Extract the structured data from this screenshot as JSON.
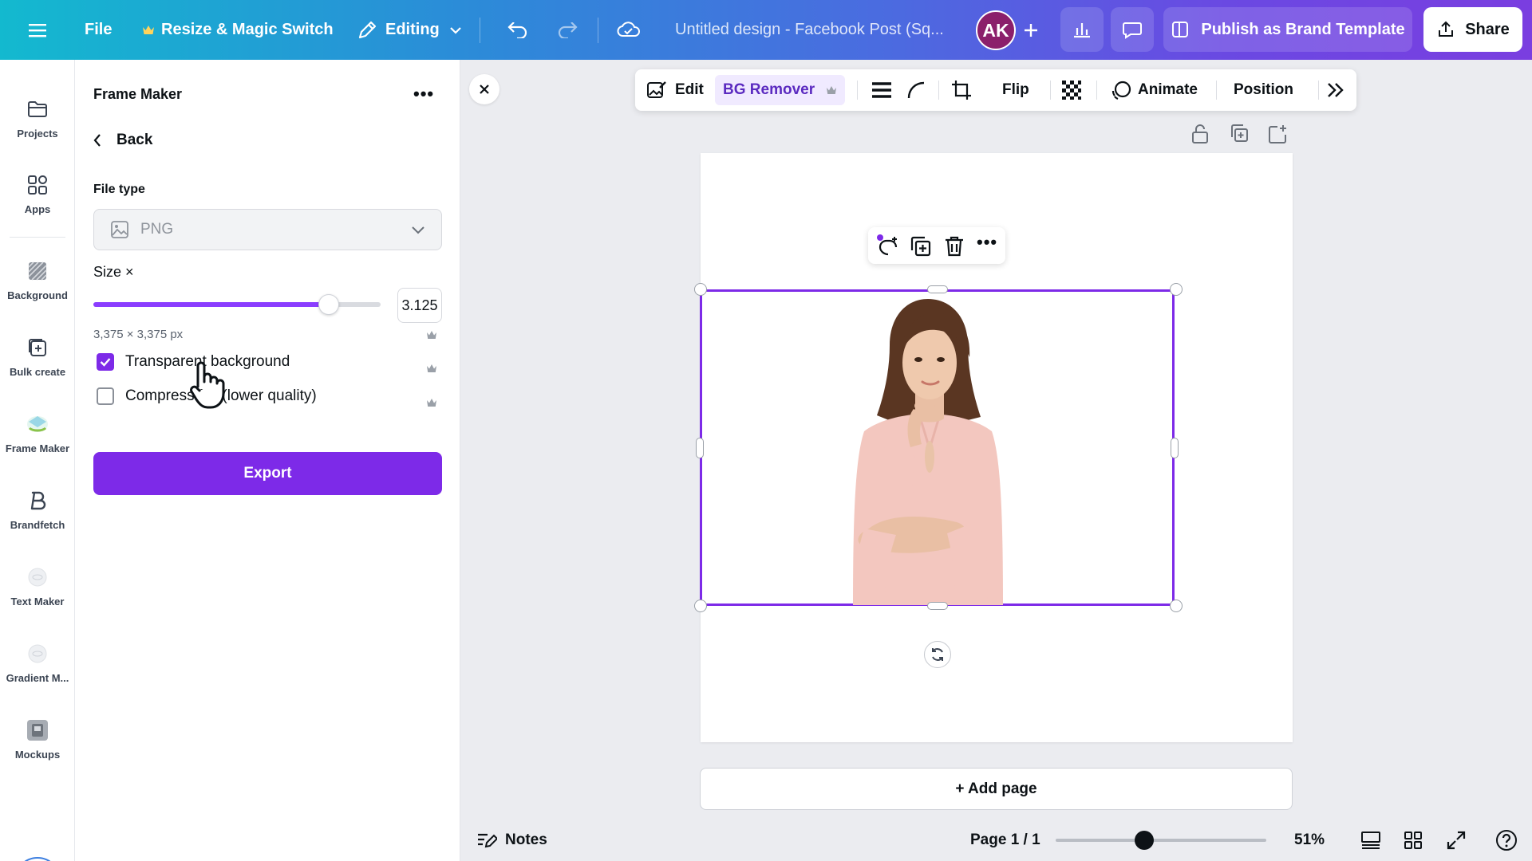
{
  "topbar": {
    "file": "File",
    "resize": "Resize & Magic Switch",
    "editing": "Editing",
    "design_title": "Untitled design - Facebook Post (Sq...",
    "avatar_initials": "AK",
    "publish": "Publish as Brand Template",
    "share": "Share"
  },
  "rail": {
    "items": [
      {
        "label": "Projects",
        "icon": "folder-icon"
      },
      {
        "label": "Apps",
        "icon": "apps-icon"
      },
      {
        "label": "Background",
        "icon": "background-icon"
      },
      {
        "label": "Bulk create",
        "icon": "bulk-create-icon"
      },
      {
        "label": "Frame Maker",
        "icon": "frame-maker-icon"
      },
      {
        "label": "Brandfetch",
        "icon": "brandfetch-icon"
      },
      {
        "label": "Text Maker",
        "icon": "text-maker-icon"
      },
      {
        "label": "Gradient M...",
        "icon": "gradient-maker-icon"
      },
      {
        "label": "Mockups",
        "icon": "mockups-icon"
      }
    ]
  },
  "panel": {
    "title": "Frame Maker",
    "back": "Back",
    "file_type_label": "File type",
    "file_type_value": "PNG",
    "size_label": "Size ×",
    "size_value": "3.125",
    "size_fraction": 0.82,
    "dimensions": "3,375 × 3,375 px",
    "transparent_label": "Transparent background",
    "transparent_checked": true,
    "compress_label": "Compress file (lower quality)",
    "compress_checked": false,
    "export": "Export"
  },
  "context_toolbar": {
    "edit": "Edit",
    "bg_remover": "BG Remover",
    "flip": "Flip",
    "animate": "Animate",
    "position": "Position"
  },
  "canvas": {
    "add_page": "+ Add page"
  },
  "bottombar": {
    "notes": "Notes",
    "page_indicator": "Page 1 / 1",
    "zoom": "51%",
    "zoom_fraction": 0.42
  },
  "colors": {
    "accent": "#7d2ae8",
    "topbar_start": "#13b9cf",
    "topbar_end": "#7a3ee0"
  }
}
